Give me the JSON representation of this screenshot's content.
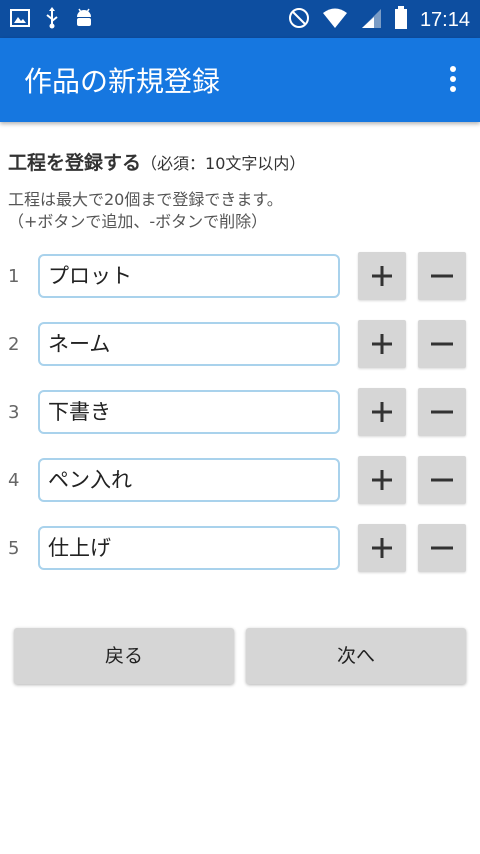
{
  "status_bar": {
    "time": "17:14",
    "icons_left": [
      "image-icon",
      "usb-icon",
      "android-icon"
    ],
    "icons_right": [
      "do-not-disturb-icon",
      "wifi-icon",
      "signal-icon",
      "battery-icon"
    ]
  },
  "app_bar": {
    "title": "作品の新規登録",
    "menu_icon": "more-vert-icon",
    "color": "#1677e0"
  },
  "section": {
    "title": "工程を登録する",
    "note": "（必須：10文字以内）",
    "desc_line1": "工程は最大で20個まで登録できます。",
    "desc_line2": "（+ボタンで追加、-ボタンで削除）"
  },
  "steps": [
    {
      "num": "1",
      "value": "プロット"
    },
    {
      "num": "2",
      "value": "ネーム"
    },
    {
      "num": "3",
      "value": "下書き"
    },
    {
      "num": "4",
      "value": "ペン入れ"
    },
    {
      "num": "5",
      "value": "仕上げ"
    }
  ],
  "buttons": {
    "back": "戻る",
    "next": "次へ"
  }
}
